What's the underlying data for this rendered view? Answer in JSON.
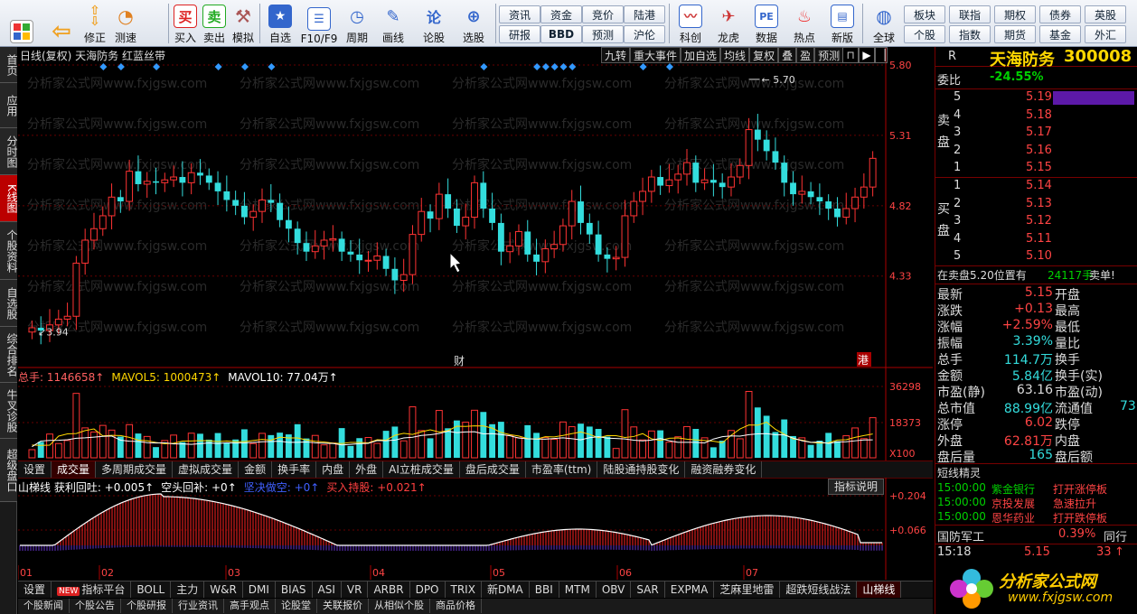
{
  "toolbar": {
    "buttons": [
      {
        "label": "",
        "icon": "grid-icon",
        "color": "#d33"
      },
      {
        "label": "",
        "icon": "back-arrow-icon",
        "color": "#f0a020"
      },
      {
        "label": "修正",
        "icon": "up-down-arrow-icon",
        "color": "#f0a020"
      },
      {
        "label": "测速",
        "icon": "clock-icon",
        "color": "#e08020"
      },
      {
        "label": "买入",
        "icon": "buy-icon",
        "color": "#d22"
      },
      {
        "label": "卖出",
        "icon": "sell-icon",
        "color": "#2a2"
      },
      {
        "label": "模拟",
        "icon": "hammer-icon",
        "color": "#a55"
      },
      {
        "label": "自选",
        "icon": "star-icon",
        "color": "#36c"
      },
      {
        "label": "F10/F9",
        "icon": "f10-icon",
        "color": "#36c"
      },
      {
        "label": "周期",
        "icon": "period-icon",
        "color": "#36c"
      },
      {
        "label": "画线",
        "icon": "pencil-icon",
        "color": "#36c"
      },
      {
        "label": "论股",
        "icon": "discuss-icon",
        "color": "#36c"
      },
      {
        "label": "选股",
        "icon": "select-stock-icon",
        "color": "#36c"
      }
    ],
    "mini1": [
      "资讯",
      "资金",
      "竞价",
      "陆港"
    ],
    "mini2": [
      "研报",
      "BBD",
      "预测",
      "沪伦"
    ],
    "buttons2": [
      {
        "label": "科创",
        "icon": "kechuang-icon"
      },
      {
        "label": "龙虎",
        "icon": "dragon-icon"
      },
      {
        "label": "数据",
        "icon": "pe-icon"
      },
      {
        "label": "热点",
        "icon": "fire-icon"
      },
      {
        "label": "新版",
        "icon": "newversion-icon"
      },
      {
        "label": "全球",
        "icon": "globe-icon"
      }
    ],
    "mini3": [
      "板块",
      "联指",
      "期权",
      "债券",
      "英股"
    ],
    "mini4": [
      "个股",
      "指数",
      "期货",
      "基金",
      "外汇"
    ]
  },
  "leftnav": [
    "首页",
    "应用",
    "分时图",
    "K线图",
    "个股资料",
    "自选股",
    "综合排名",
    "牛叉诊股",
    "超级盘口"
  ],
  "chart": {
    "title": "日线(复权) 天海防务 红蓝丝带",
    "top_buttons": [
      "九转",
      "重大事件",
      "加自选",
      "均线",
      "复权",
      "叠",
      "盈",
      "预测"
    ],
    "price_axis": [
      "5.80",
      "5.31",
      "4.82",
      "4.33"
    ],
    "high_label": "5.70",
    "low_label": "3.94",
    "markers": [
      "财",
      "港"
    ],
    "watermark": "分析家公式网www.fxjgsw.com"
  },
  "volume": {
    "legend": [
      {
        "text": "总手: 1146658↑",
        "color": "#ff6060"
      },
      {
        "text": "MAVOL5: 1000473↑",
        "color": "#ffd700"
      },
      {
        "text": "MAVOL10: 77.04万↑",
        "color": "#ffffff"
      }
    ],
    "axis": [
      "36298",
      "18373",
      "X100"
    ]
  },
  "tabs1": [
    "设置",
    "成交量",
    "多周期成交量",
    "虚拟成交量",
    "金额",
    "换手率",
    "内盘",
    "外盘",
    "AI立桩成交量",
    "盘后成交量",
    "市盈率(ttm)",
    "陆股通持股变化",
    "融资融券变化"
  ],
  "indicator": {
    "legend": [
      {
        "text": "山梯线 获利回吐: +0.005↑",
        "color": "#ffffff"
      },
      {
        "text": "空头回补: +0↑",
        "color": "#ffffff"
      },
      {
        "text": "坚决做空: +0↑",
        "color": "#4060ff"
      },
      {
        "text": "买入持股: +0.021↑",
        "color": "#ff4040"
      }
    ],
    "explain": "指标说明",
    "axis": [
      "+0.204",
      "+0.066"
    ]
  },
  "date_axis": [
    "01",
    "02",
    "03",
    "04",
    "05",
    "06",
    "07"
  ],
  "tabs2": [
    "设置",
    "指标平台",
    "BOLL",
    "主力",
    "W&R",
    "DMI",
    "BIAS",
    "ASI",
    "VR",
    "ARBR",
    "DPO",
    "TRIX",
    "新DMA",
    "BBI",
    "MTM",
    "OBV",
    "SAR",
    "EXPMA",
    "芝麻里地雷",
    "超跌短线战法",
    "山梯线"
  ],
  "tabs2_new": "NEW",
  "tabs3": [
    "个股新闻",
    "个股公告",
    "个股研报",
    "行业资讯",
    "高手观点",
    "论股堂",
    "关联报价",
    "从相似个股",
    "商品价格"
  ],
  "quote": {
    "name": "天海防务",
    "code": "300008",
    "flag": "R",
    "weibi_label": "委比",
    "weibi": "-24.55%",
    "sell_label": "卖盘",
    "buy_label": "买盘",
    "sells": [
      {
        "n": "5",
        "p": "5.19"
      },
      {
        "n": "4",
        "p": "5.18"
      },
      {
        "n": "3",
        "p": "5.17"
      },
      {
        "n": "2",
        "p": "5.16"
      },
      {
        "n": "1",
        "p": "5.15"
      }
    ],
    "buys": [
      {
        "n": "1",
        "p": "5.14"
      },
      {
        "n": "2",
        "p": "5.13"
      },
      {
        "n": "3",
        "p": "5.12"
      },
      {
        "n": "4",
        "p": "5.11"
      },
      {
        "n": "5",
        "p": "5.10"
      }
    ],
    "alert": {
      "text": "在卖盘5.20位置有",
      "vol": "24117手",
      "action": "卖单!"
    },
    "stats": [
      {
        "l": "最新",
        "v": "5.15",
        "vc": "#ff4444",
        "l2": "开盘",
        "v2": ""
      },
      {
        "l": "涨跌",
        "v": "+0.13",
        "vc": "#ff4444",
        "l2": "最高",
        "v2": ""
      },
      {
        "l": "涨幅",
        "v": "+2.59%",
        "vc": "#ff4444",
        "l2": "最低",
        "v2": ""
      },
      {
        "l": "振幅",
        "v": "3.39%",
        "vc": "#33dddd",
        "l2": "量比",
        "v2": ""
      },
      {
        "l": "总手",
        "v": "114.7万",
        "vc": "#33dddd",
        "l2": "换手",
        "v2": ""
      },
      {
        "l": "金额",
        "v": "5.84亿",
        "vc": "#33dddd",
        "l2": "换手(实)",
        "v2": ""
      },
      {
        "l": "市盈(静)",
        "v": "63.16",
        "vc": "#dddddd",
        "l2": "市盈(动)",
        "v2": ""
      },
      {
        "l": "总市值",
        "v": "88.99亿",
        "vc": "#33dddd",
        "l2": "流通值",
        "v2": "73"
      },
      {
        "l": "涨停",
        "v": "6.02",
        "vc": "#ff4444",
        "l2": "跌停",
        "v2": ""
      },
      {
        "l": "外盘",
        "v": "62.81万",
        "vc": "#ff4444",
        "l2": "内盘",
        "v2": ""
      },
      {
        "l": "盘后量",
        "v": "165",
        "vc": "#33dddd",
        "l2": "盘后额",
        "v2": ""
      }
    ],
    "jingling_title": "短线精灵",
    "jingling": [
      {
        "t": "15:00:00",
        "s": "紫金银行",
        "a": "打开涨停板",
        "sc": "#00d000",
        "ac": "#ff4444"
      },
      {
        "t": "15:00:00",
        "s": "京投发展",
        "a": "急速拉升",
        "sc": "#ff4444",
        "ac": "#ff4444"
      },
      {
        "t": "15:00:00",
        "s": "恩华药业",
        "a": "打开跌停板",
        "sc": "#ff4444",
        "ac": "#ff4444"
      }
    ],
    "sector": {
      "name": "国防军工",
      "pct": "0.39%",
      "right": "同行"
    },
    "tick": {
      "time": "15:18",
      "price": "5.15",
      "vol": "33"
    },
    "logo_text": "分析家公式网",
    "logo_url": "www.fxjgsw.com"
  }
}
